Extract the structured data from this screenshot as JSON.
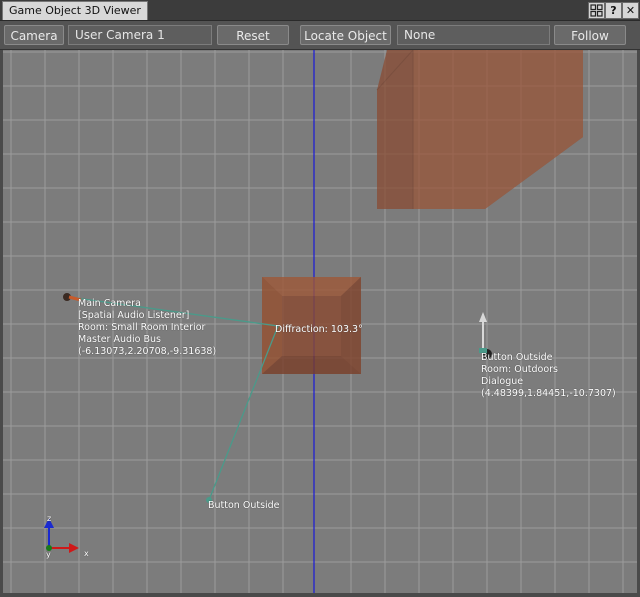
{
  "window": {
    "title": "Game Object 3D Viewer"
  },
  "toolbar": {
    "camera_label": "Camera >",
    "camera_value": "User Camera 1",
    "reset_label": "Reset",
    "locate_label": "Locate Object >",
    "locate_value": "None",
    "follow_label": "Follow"
  },
  "scene": {
    "main_camera": {
      "name": "Main Camera",
      "type": "[Spatial Audio Listener]",
      "room": "Room: Small Room Interior",
      "bus": "Master Audio Bus",
      "position": "(-6.13073,2.20708,-9.31638)"
    },
    "diffraction": "Diffraction: 103.3°",
    "emitter": {
      "name": "Button Outside",
      "room": "Room: Outdoors",
      "bus": "Dialogue",
      "position": "(4.48399,1.84451,-10.7307)"
    },
    "path_endpoint": "Button Outside",
    "axes": {
      "x": "x",
      "y": "y",
      "z": "z"
    }
  },
  "colors": {
    "axis_x": "#d01818",
    "axis_y": "#1a7a1a",
    "axis_z": "#1a2ad0",
    "room_fill": "#8a4a30",
    "path_line": "#4a9a8a"
  },
  "icons": {
    "window_menu": "grid-icon",
    "help": "help-icon",
    "close": "close-icon"
  }
}
